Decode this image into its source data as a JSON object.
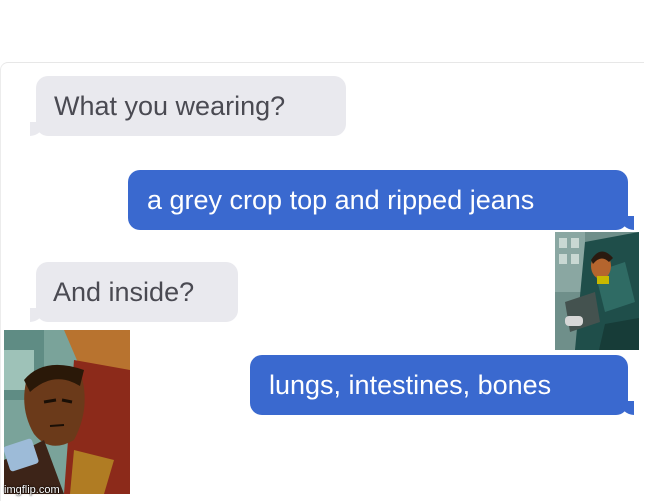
{
  "conversation": {
    "messages": [
      {
        "direction": "incoming",
        "text": "What you wearing?"
      },
      {
        "direction": "outgoing",
        "text": "a grey crop top and ripped jeans"
      },
      {
        "direction": "incoming",
        "text": "And inside?"
      },
      {
        "direction": "outgoing",
        "text": "lungs, intestines, bones"
      }
    ]
  },
  "colors": {
    "incoming_bubble": "#e9e9ee",
    "outgoing_bubble": "#3a69cf",
    "background": "#ffffff"
  },
  "watermark": "imgflip.com"
}
